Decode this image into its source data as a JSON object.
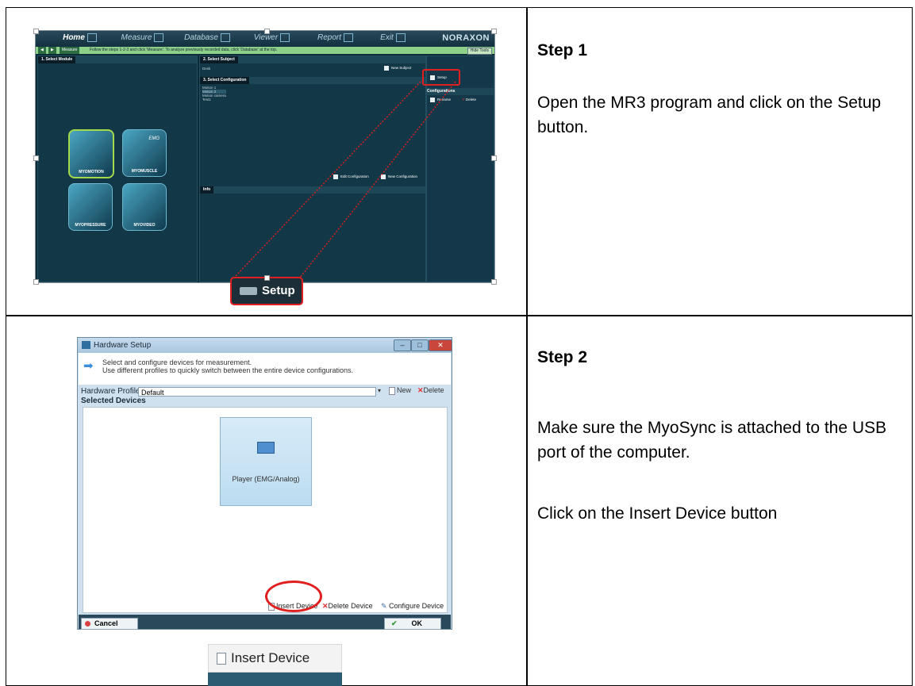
{
  "step1": {
    "title": "Step 1",
    "text": "Open the MR3 program and click on the Setup button.",
    "screenshot": {
      "tabs": [
        "Home",
        "Measure",
        "Database",
        "Viewer",
        "Report",
        "Exit"
      ],
      "brand": "NORAXON",
      "measure_label": "Measure",
      "hint": "Follow the steps 1-2-3 and click 'Measure'. To analyze previously recorded data, click 'Database' at the top.",
      "hide_tools": "Hide Tools",
      "select_module": "1. Select Module",
      "select_subject": "2. Select Subject",
      "subject_value": "Desk",
      "new_subject": "New Subject",
      "select_configuration": "3. Select Configuration",
      "configurations": [
        "Motion 1",
        "Motion 2",
        "Motion camera",
        "Test1"
      ],
      "edit_configuration": "Edit Configuration",
      "new_configuration": "New Configuration",
      "info": "Info",
      "setup_small": "Setup",
      "configurations_label": "Configurations",
      "rename": "Rename",
      "delete": "Delete",
      "modules": [
        "MYOMOTION",
        "MYOMUSCLE",
        "MYOPRESSURE",
        "MYOVIDEO"
      ],
      "emg_badge": "EMG"
    },
    "setup_callout": "Setup"
  },
  "step2": {
    "title": "Step 2",
    "text1": "Make sure the MyoSync is attached to the USB port of the computer.",
    "text2": "Click on the Insert Device button",
    "dialog": {
      "title": "Hardware Setup",
      "desc_line1": "Select and configure devices for measurement.",
      "desc_line2": "Use different profiles to quickly switch between the entire device configurations.",
      "profile_label": "Hardware Profile",
      "profile_value": "Default",
      "new": "New",
      "delete": "Delete",
      "selected_devices": "Selected Devices",
      "device_label": "Player (EMG/Analog)",
      "insert_device": "Insert Device",
      "delete_device": "Delete Device",
      "configure_device": "Configure Device",
      "cancel": "Cancel",
      "ok": "OK"
    },
    "insert_callout": "Insert Device"
  }
}
